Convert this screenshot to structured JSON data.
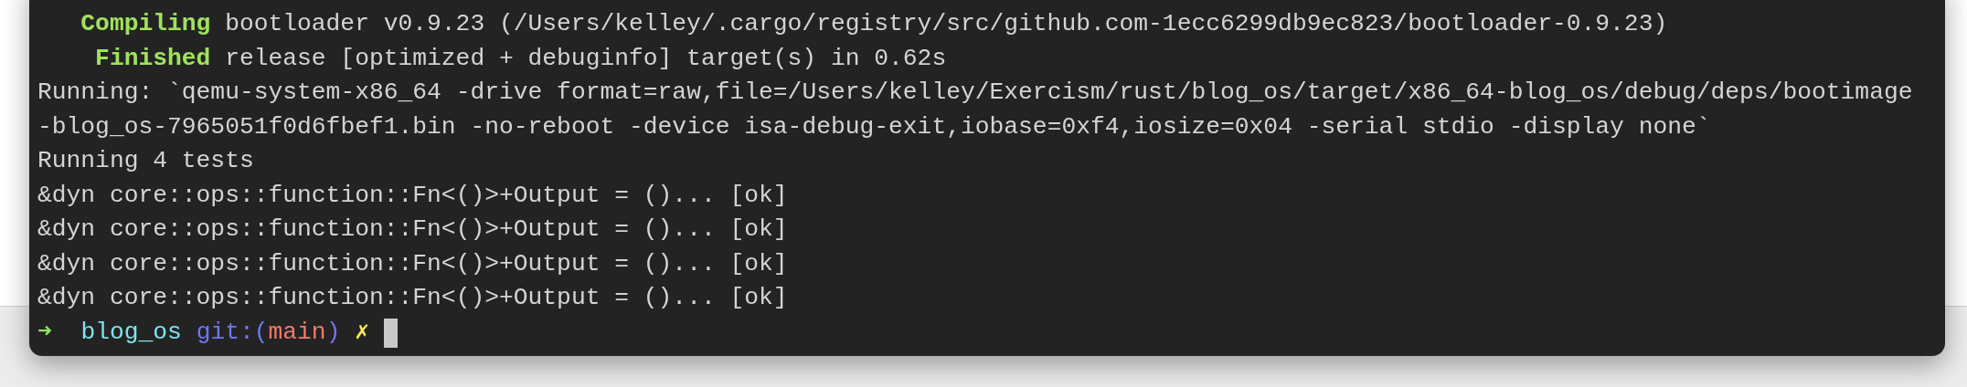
{
  "terminal": {
    "lines": [
      {
        "kind": "status",
        "label": "Compiling",
        "text": "bootloader v0.9.23 (/Users/kelley/.cargo/registry/src/github.com-1ecc6299db9ec823/bootloader-0.9.23)"
      },
      {
        "kind": "status",
        "label": "Finished",
        "text": "release [optimized + debuginfo] target(s) in 0.62s"
      },
      {
        "kind": "plain",
        "text": "Running: `qemu-system-x86_64 -drive format=raw,file=/Users/kelley/Exercism/rust/blog_os/target/x86_64-blog_os/debug/deps/bootimage"
      },
      {
        "kind": "plain",
        "text": "-blog_os-7965051f0d6fbef1.bin -no-reboot -device isa-debug-exit,iobase=0xf4,iosize=0x04 -serial stdio -display none`"
      },
      {
        "kind": "plain",
        "text": "Running 4 tests"
      },
      {
        "kind": "plain",
        "text": "&dyn core::ops::function::Fn<()>+Output = ()... [ok]"
      },
      {
        "kind": "plain",
        "text": "&dyn core::ops::function::Fn<()>+Output = ()... [ok]"
      },
      {
        "kind": "plain",
        "text": "&dyn core::ops::function::Fn<()>+Output = ()... [ok]"
      },
      {
        "kind": "plain",
        "text": "&dyn core::ops::function::Fn<()>+Output = ()... [ok]"
      }
    ],
    "prompt": {
      "arrow": "➜",
      "directory": "blog_os",
      "git_prefix": "git:(",
      "branch": "main",
      "git_suffix": ")",
      "dirty_mark": "✗"
    }
  }
}
